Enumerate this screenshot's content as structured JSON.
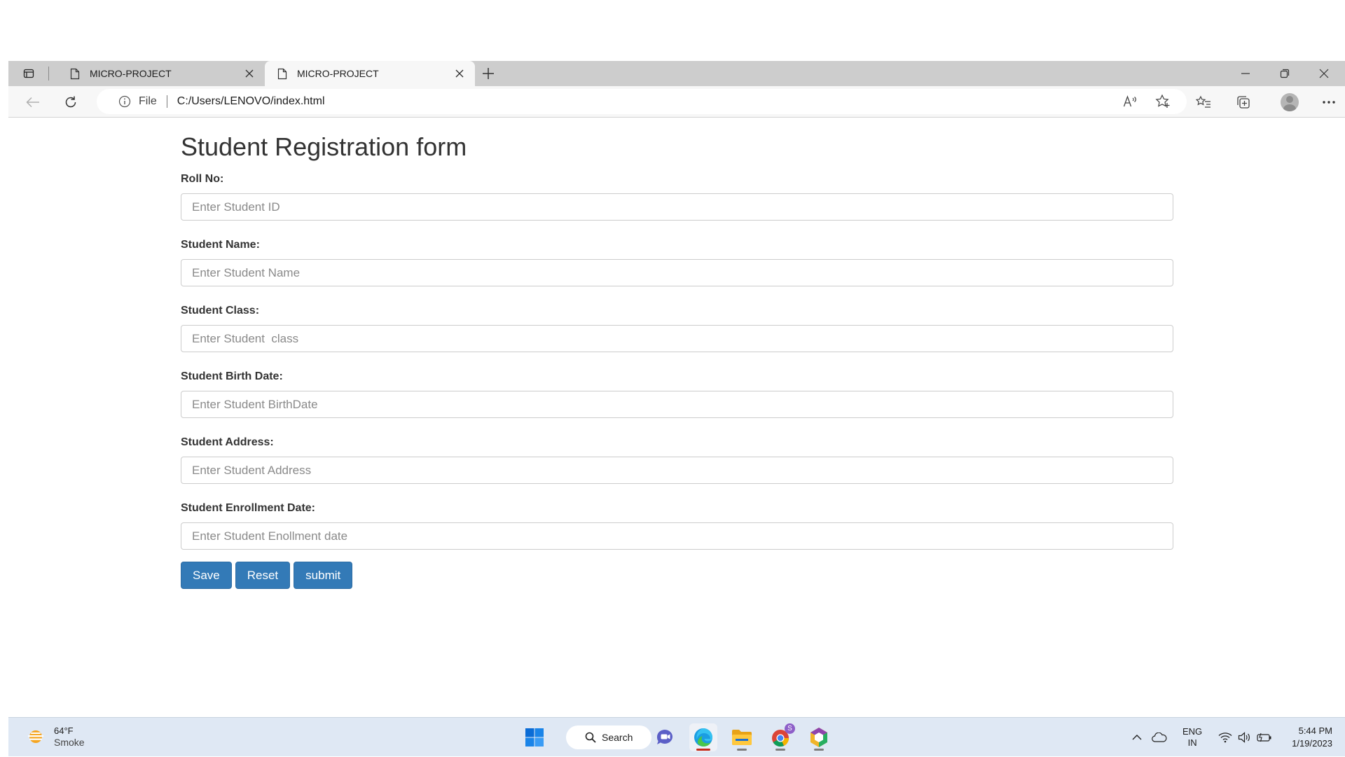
{
  "browser": {
    "tabs": [
      {
        "title": "MICRO-PROJECT"
      },
      {
        "title": "MICRO-PROJECT"
      }
    ],
    "address": {
      "scheme_label": "File",
      "url": "C:/Users/LENOVO/index.html"
    }
  },
  "form": {
    "title": "Student Registration form",
    "fields": [
      {
        "label": "Roll No:",
        "placeholder": "Enter Student ID"
      },
      {
        "label": "Student Name:",
        "placeholder": "Enter Student Name"
      },
      {
        "label": "Student Class:",
        "placeholder": "Enter Student  class"
      },
      {
        "label": "Student Birth Date:",
        "placeholder": "Enter Student BirthDate"
      },
      {
        "label": "Student Address:",
        "placeholder": "Enter Student Address"
      },
      {
        "label": "Student Enrollment Date:",
        "placeholder": "Enter Student Enollment date"
      }
    ],
    "buttons": {
      "save": "Save",
      "reset": "Reset",
      "submit": "submit"
    },
    "colors": {
      "button_bg": "#337ab7",
      "button_border": "#2e6da4"
    }
  },
  "taskbar": {
    "weather": {
      "temp": "64°F",
      "condition": "Smoke"
    },
    "search_label": "Search",
    "chrome_badge": "S",
    "language": {
      "line1": "ENG",
      "line2": "IN"
    },
    "clock": {
      "time": "5:44 PM",
      "date": "1/19/2023"
    }
  }
}
